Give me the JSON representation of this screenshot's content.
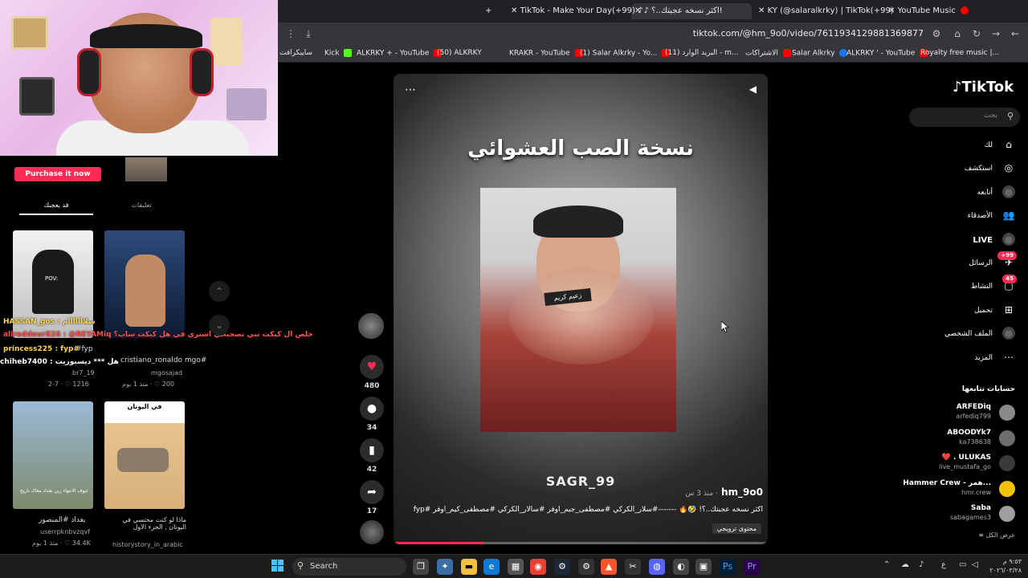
{
  "browser": {
    "tabs": [
      {
        "label": "YouTube Music",
        "active": false
      },
      {
        "label": "KY (@salaralkrky) | TikTok(+99)",
        "active": false
      },
      {
        "label": "اكثر نسخه عجبتك..؟!",
        "active": true
      },
      {
        "label": "TikTok - Make Your Day(+99)",
        "active": false
      }
    ],
    "new_tab": "+",
    "url": "tiktok.com/@hm_9o0/video/7611934129881369877",
    "bookmarks": [
      {
        "label": "سايبكرافت",
        "color": "#1a73e8"
      },
      {
        "label": "Kick",
        "color": "#53fc18"
      },
      {
        "label": "ALKRKY + - YouTube",
        "color": "#ff0000"
      },
      {
        "label": "(50) ALKRKY",
        "color": "#e53935"
      },
      {
        "label": "KRAKR - YouTube",
        "color": "#ff0000"
      },
      {
        "label": "(1) Salar Alkrky - Yo...",
        "color": "#ff0000"
      },
      {
        "label": "(11) البريد الوارد - m...",
        "color": "#d93025"
      },
      {
        "label": "الاشتراكات",
        "color": "#ff0000"
      },
      {
        "label": "Salar Alkrky",
        "color": "#1877f2"
      },
      {
        "label": "ALKRKY ' - YouTube",
        "color": "#ff0000"
      },
      {
        "label": "Royalty free music |...",
        "color": "#ffffff"
      }
    ]
  },
  "left": {
    "purchase_button": "Purchase it now",
    "tabs": {
      "liked": "قد يعجبك",
      "comments": "تعليقات"
    },
    "chat": [
      {
        "text": "HASSAN_gos : سلااااااام",
        "color": "#ffd54f"
      },
      {
        "text": "alireddour826 : @REYAMiq خلص ال كيكت تبي تصحيحي اشتري في هل كيكت ساب؟",
        "color": "#ff5252"
      },
      {
        "text": "princess225 : fyp#",
        "color": "#ffd54f"
      },
      {
        "text": "chiheb7400 : هل *** ديسبوزيت",
        "color": "#ffffff"
      }
    ],
    "thumbnails": [
      {
        "caption": "fyp#",
        "author": "br7_19",
        "stats": "1216 ♡ · 2-7"
      },
      {
        "caption": "cristiano_ronaldo mgo#",
        "author": "mgosajad",
        "stats": "200 ♡ · منذ 1 يوم"
      },
      {
        "caption": "بغداد #المنصور",
        "author": "userrpknbvzqvf",
        "stats": "34.4K ♡ · منذ 1 يوم"
      },
      {
        "caption": "ماذا لو كنت محتسي في اليونان , الجزء الاول",
        "author": "historystory_in_arabic",
        "stats": "",
        "overlay": "في اليونان"
      }
    ],
    "thumb_overlay_1": "POV:",
    "thumb_overlay_3": "ثيوف الانتهاء زين بغداد معاك ناريخ"
  },
  "video": {
    "title": "نسخة الصب العشوائي",
    "watermark": "SAGR_99",
    "inner_tag": "زعيم كريم",
    "author": "hm_9o0",
    "time": "منذ 3 س",
    "description": "اكثر نسخه عجبتك..؟! 🤣🔥 -------#سلار_الكركي #مصطفى_جيم_اوفر #سالار_الكركي #مصطفى_كيم_اوفر #fyp",
    "label": "محتوى ترويجي",
    "progress": 0.24,
    "likes": "480",
    "comments": "34",
    "saves": "42",
    "shares": "17"
  },
  "sidebar": {
    "logo": "TikTok",
    "search_placeholder": "بحث",
    "nav": [
      {
        "label": "لك",
        "icon": "home-icon",
        "glyph": "⌂"
      },
      {
        "label": "استكشف",
        "icon": "compass-icon",
        "glyph": "◎"
      },
      {
        "label": "أتابعه",
        "icon": "following-avatar-icon",
        "glyph": "●"
      },
      {
        "label": "الأصدقاء",
        "icon": "friends-icon",
        "glyph": "👥"
      },
      {
        "label": "LIVE",
        "icon": "live-icon",
        "glyph": "●"
      },
      {
        "label": "الرسائل",
        "icon": "messages-icon",
        "glyph": "✈",
        "badge": "+99"
      },
      {
        "label": "النشاط",
        "icon": "activity-icon",
        "glyph": "▢",
        "badge": "45"
      },
      {
        "label": "تحميل",
        "icon": "upload-icon",
        "glyph": "⊞"
      },
      {
        "label": "الملف الشخصي",
        "icon": "profile-icon",
        "glyph": "●"
      },
      {
        "label": "المزيد",
        "icon": "more-icon",
        "glyph": "⋯"
      }
    ],
    "following_title": "حسابات تتابعها",
    "following": [
      {
        "name": "ARFEDiq",
        "handle": "arfediq799",
        "color": "#8a8a8a"
      },
      {
        "name": "ABOODYk7",
        "handle": "ka738638",
        "color": "#6d6d6d"
      },
      {
        "name": "❤️ . ULUKAS",
        "handle": "live_mustafa_go",
        "color": "#3a3a3a"
      },
      {
        "name": "Hammer Crew - همر...",
        "handle": "hmr.crew",
        "color": "#f4c20d"
      },
      {
        "name": "Saba",
        "handle": "sabagames3",
        "color": "#9e9e9e"
      }
    ],
    "see_all": "عرض الكل"
  },
  "taskbar": {
    "search": "Search",
    "time": "٩:٥٣ م",
    "date": "٢٠٢٦/٠٣/٢٨",
    "lang": "ع"
  }
}
